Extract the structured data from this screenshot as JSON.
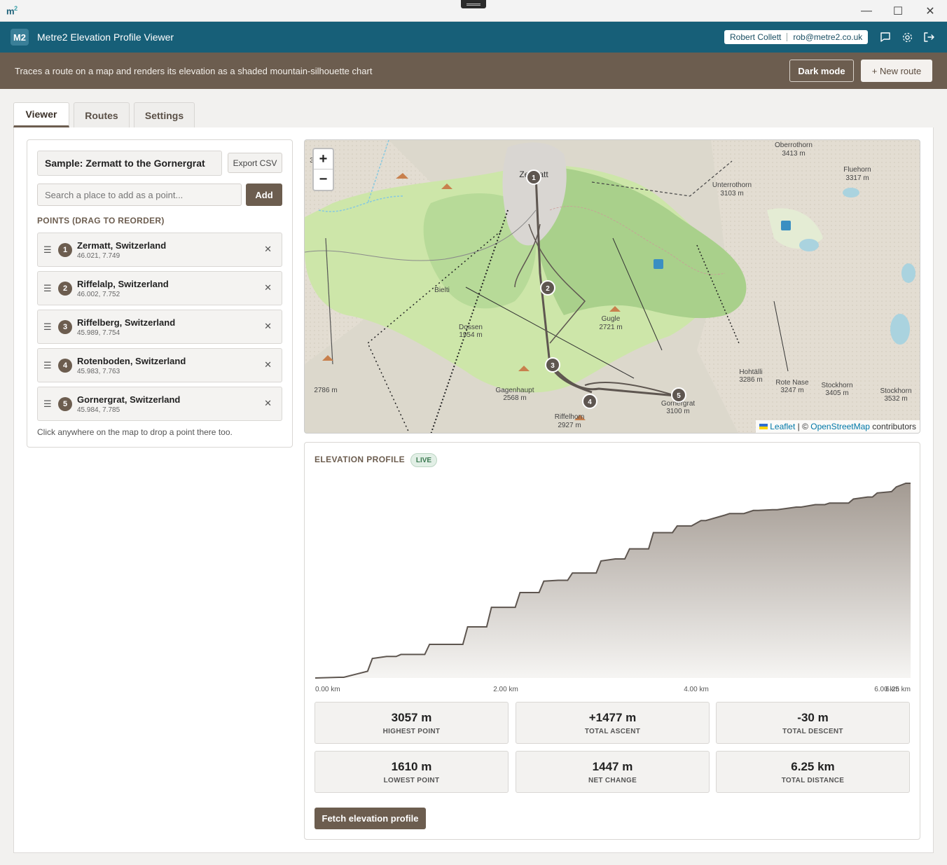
{
  "window": {
    "logo": "m",
    "logo_sup": "2",
    "controls": {
      "minimize": "—",
      "maximize": "☐",
      "close": "✕"
    }
  },
  "app": {
    "badge": "M2",
    "title": "Metre2 Elevation Profile Viewer",
    "user_name": "Robert Collett",
    "user_email": "rob@metre2.co.uk"
  },
  "subheader": {
    "description": "Traces a route on a map and renders its elevation as a shaded mountain-silhouette chart",
    "dark_mode_label": "Dark mode",
    "new_route_label": "+ New route"
  },
  "tabs": [
    {
      "label": "Viewer",
      "active": true
    },
    {
      "label": "Routes",
      "active": false
    },
    {
      "label": "Settings",
      "active": false
    }
  ],
  "route": {
    "name": "Sample: Zermatt to the Gornergrat",
    "export_label": "Export CSV",
    "search_placeholder": "Search a place to add as a point...",
    "add_label": "Add",
    "points_heading": "POINTS (DRAG TO REORDER)",
    "hint": "Click anywhere on the map to drop a point there too.",
    "points": [
      {
        "num": "1",
        "name": "Zermatt, Switzerland",
        "coords": "46.021, 7.749"
      },
      {
        "num": "2",
        "name": "Riffelalp, Switzerland",
        "coords": "46.002, 7.752"
      },
      {
        "num": "3",
        "name": "Riffelberg, Switzerland",
        "coords": "45.989, 7.754"
      },
      {
        "num": "4",
        "name": "Rotenboden, Switzerland",
        "coords": "45.983, 7.763"
      },
      {
        "num": "5",
        "name": "Gornergrat, Switzerland",
        "coords": "45.984, 7.785"
      }
    ]
  },
  "map": {
    "zoom_in": "+",
    "zoom_out": "−",
    "attribution_leaflet": "Leaflet",
    "attribution_sep": " | © ",
    "attribution_osm": "OpenStreetMap",
    "attribution_tail": " contributors",
    "labels": [
      "Oberrothorn",
      "3413 m",
      "Fluehorn",
      "3317 m",
      "Unterrothorn",
      "3103 m",
      "Zermatt",
      "Bielti",
      "Dossen",
      "1954 m",
      "Gugle",
      "2721 m",
      "Gagenhaupt",
      "2568 m",
      "Riffelhorn",
      "2927 m",
      "Gornergrat",
      "3100 m",
      "Hohtälli",
      "3286 m",
      "Rote Nase",
      "3247 m",
      "Stockhorn",
      "3405 m",
      "Stockhorn",
      "3532 m",
      "2786 m",
      "3"
    ]
  },
  "elevation": {
    "title": "ELEVATION PROFILE",
    "badge": "LIVE",
    "fetch_label": "Fetch elevation profile",
    "stats": [
      {
        "value": "3057 m",
        "label": "HIGHEST POINT"
      },
      {
        "value": "+1477 m",
        "label": "TOTAL ASCENT"
      },
      {
        "value": "-30 m",
        "label": "TOTAL DESCENT"
      },
      {
        "value": "1610 m",
        "label": "LOWEST POINT"
      },
      {
        "value": "1447 m",
        "label": "NET CHANGE"
      },
      {
        "value": "6.25 km",
        "label": "TOTAL DISTANCE"
      }
    ]
  },
  "chart_data": {
    "type": "area",
    "xlabel": "",
    "ylabel": "",
    "x_tick_labels": [
      "0.00 km",
      "2.00 km",
      "4.00 km",
      "6.00 km",
      "6.25 km"
    ],
    "x_ticks": [
      0,
      2,
      4,
      6,
      6.25
    ],
    "xlim": [
      0,
      6.25
    ],
    "ylim": [
      1610,
      3057
    ],
    "grid": false,
    "series": [
      {
        "x": [
          0,
          0.25,
          0.3,
          0.55,
          0.6,
          0.75,
          0.85,
          0.9,
          1.15,
          1.2,
          1.55,
          1.6,
          1.8,
          1.85,
          2.1,
          2.15,
          2.35,
          2.4,
          2.55,
          2.65,
          2.7,
          2.95,
          3.0,
          3.15,
          3.25,
          3.3,
          3.5,
          3.55,
          3.75,
          3.8,
          3.95,
          4.05,
          4.1,
          4.3,
          4.35,
          4.5,
          4.6,
          4.65,
          4.8,
          4.85,
          5.05,
          5.1,
          5.25,
          5.35,
          5.4,
          5.6,
          5.65,
          5.8,
          5.85,
          5.9,
          6.05,
          6.1,
          6.2,
          6.25
        ],
        "y": [
          1610,
          1615,
          1615,
          1660,
          1755,
          1770,
          1770,
          1785,
          1785,
          1860,
          1860,
          1990,
          1990,
          2135,
          2135,
          2245,
          2245,
          2330,
          2336,
          2336,
          2390,
          2390,
          2480,
          2495,
          2495,
          2570,
          2570,
          2690,
          2690,
          2740,
          2740,
          2780,
          2780,
          2820,
          2832,
          2832,
          2855,
          2855,
          2860,
          2860,
          2880,
          2880,
          2898,
          2898,
          2910,
          2910,
          2940,
          2955,
          2955,
          2985,
          2995,
          3030,
          3057,
          3057
        ]
      }
    ]
  }
}
